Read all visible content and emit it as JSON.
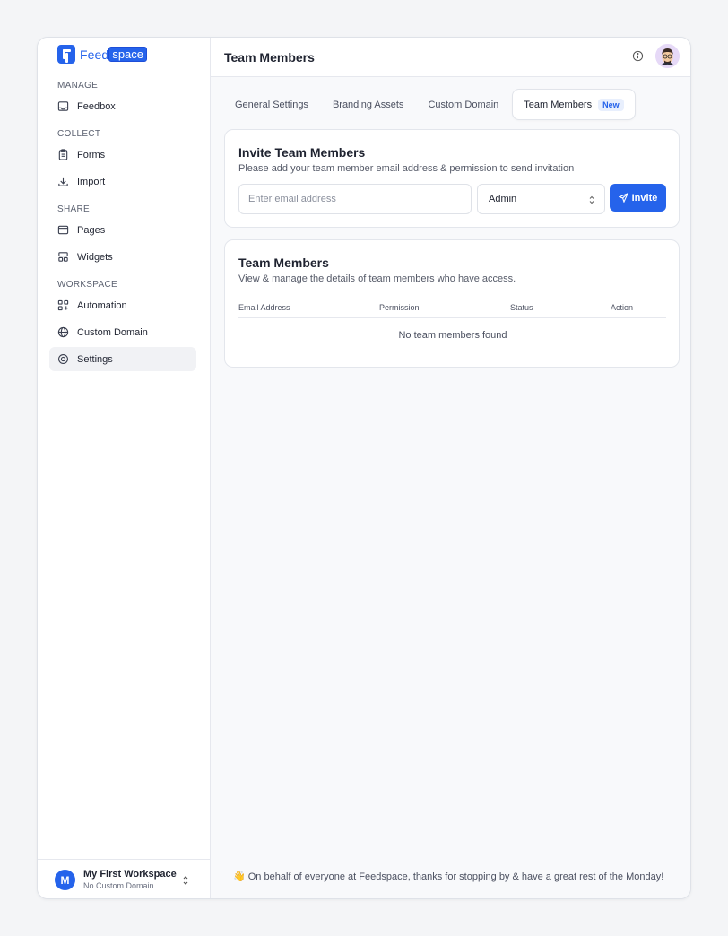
{
  "brand": {
    "name_part1": "Feed",
    "name_part2": "space",
    "color": "#2563eb"
  },
  "sidebar": {
    "sections": [
      {
        "label": "MANAGE"
      },
      {
        "label": "COLLECT"
      },
      {
        "label": "SHARE"
      },
      {
        "label": "WORKSPACE"
      }
    ],
    "items": [
      {
        "label": "Feedbox",
        "icon": "inbox-icon"
      },
      {
        "label": "Forms",
        "icon": "clipboard-icon"
      },
      {
        "label": "Import",
        "icon": "download-icon"
      },
      {
        "label": "Pages",
        "icon": "browser-icon"
      },
      {
        "label": "Widgets",
        "icon": "widgets-icon"
      },
      {
        "label": "Automation",
        "icon": "automation-icon"
      },
      {
        "label": "Custom Domain",
        "icon": "globe-icon"
      },
      {
        "label": "Settings",
        "icon": "settings-icon",
        "active": true
      }
    ]
  },
  "workspace": {
    "initial": "M",
    "name": "My First Workspace",
    "domain": "No Custom Domain"
  },
  "header": {
    "title": "Team Members"
  },
  "tabs": [
    {
      "label": "General Settings"
    },
    {
      "label": "Branding Assets"
    },
    {
      "label": "Custom Domain"
    },
    {
      "label": "Team Members",
      "badge": "New",
      "active": true
    }
  ],
  "invite": {
    "title": "Invite Team Members",
    "subtitle": "Please add your team member email address & permission to send invitation",
    "email_placeholder": "Enter email address",
    "permission_value": "Admin",
    "button_label": "Invite"
  },
  "members": {
    "title": "Team Members",
    "subtitle": "View & manage the details of team members who have access.",
    "columns": [
      "Email Address",
      "Permission",
      "Status",
      "Action"
    ],
    "rows": [],
    "empty_message": "No team members found"
  },
  "footer": {
    "message": "👋 On behalf of everyone at Feedspace, thanks for stopping by & have a great rest of the Monday!"
  }
}
